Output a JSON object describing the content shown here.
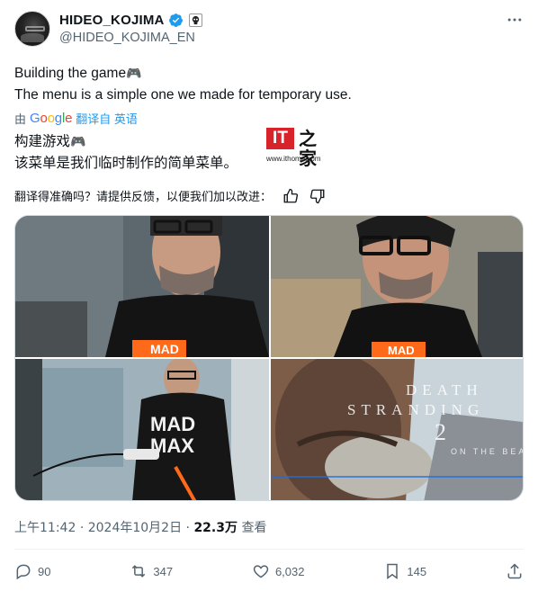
{
  "author": {
    "display_name": "HIDEO_KOJIMA",
    "handle": "@HIDEO_KOJIMA_EN"
  },
  "tweet": {
    "line1": "Building the game",
    "line2": "The menu is a simple one we made for temporary use.",
    "gamepad_emoji": "🎮"
  },
  "translation": {
    "prefix": "由",
    "google": [
      "G",
      "o",
      "o",
      "g",
      "l",
      "e"
    ],
    "link": "翻译自 英语",
    "line1": "构建游戏",
    "line2": "该菜单是我们临时制作的简单菜单。"
  },
  "watermark": {
    "logo_text": "IT",
    "logo_char": "之家",
    "url": "www.ithome.com"
  },
  "feedback": {
    "question": "翻译得准确吗？请提供反馈，以便我们加以改进："
  },
  "meta": {
    "time": "上午11:42",
    "separator": "·",
    "date": "2024年10月2日",
    "views_count": "22.3万",
    "views_label": "查看"
  },
  "actions": {
    "replies": "90",
    "reposts": "347",
    "likes": "6,032",
    "bookmarks": "145"
  },
  "photo_text": {
    "shirt_logo": "MAD",
    "shirt_logo_2": "MAX",
    "game_title_1": "DEATH",
    "game_title_2": "STRANDING",
    "game_title_3": "2",
    "game_subtitle": "ON THE BEACH"
  },
  "colors": {
    "accent": "#1d9bf0",
    "verified": "#1d9bf0",
    "secondary_text": "#536471"
  }
}
